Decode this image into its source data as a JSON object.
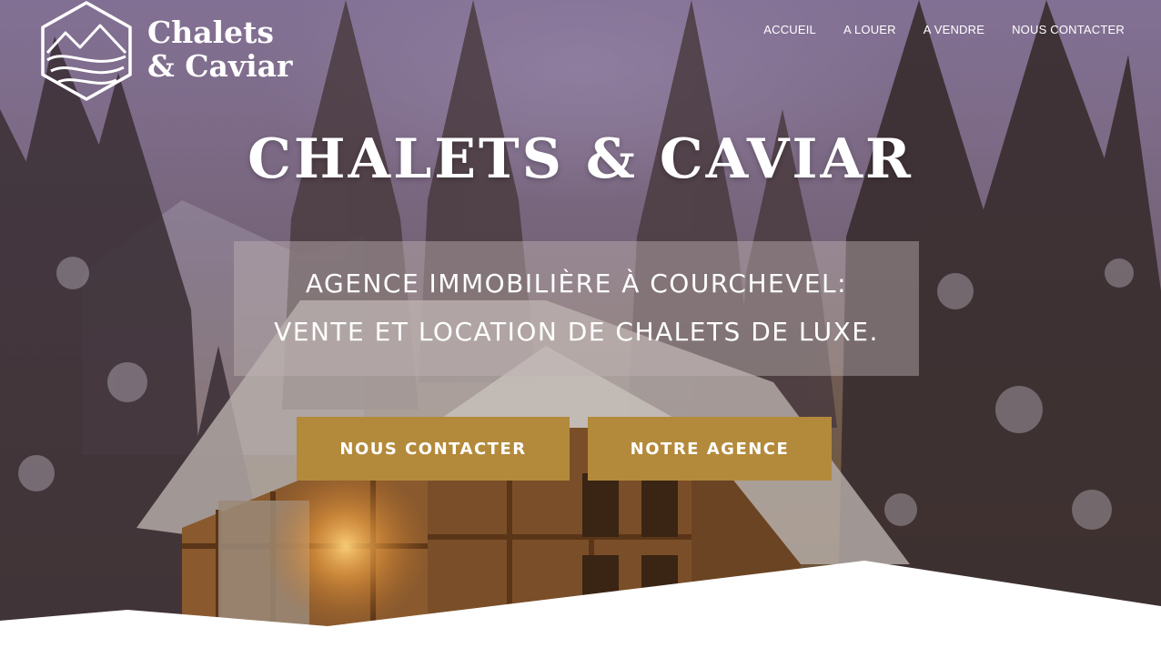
{
  "brand": {
    "line1": "Chalets",
    "line2": "& Caviar"
  },
  "nav": {
    "items": [
      {
        "label": "ACCUEIL"
      },
      {
        "label": "A LOUER"
      },
      {
        "label": "A VENDRE"
      },
      {
        "label": "NOUS CONTACTER"
      }
    ]
  },
  "hero": {
    "title": "CHALETS & CAVIAR",
    "subtitle_line1": "AGENCE IMMOBILIÈRE À COURCHEVEL:",
    "subtitle_line2": "VENTE ET LOCATION DE CHALETS DE LUXE.",
    "cta_contact": "NOUS CONTACTER",
    "cta_agence": "NOTRE AGENCE"
  },
  "colors": {
    "accent": "#b38a3b",
    "text": "#ffffff"
  }
}
